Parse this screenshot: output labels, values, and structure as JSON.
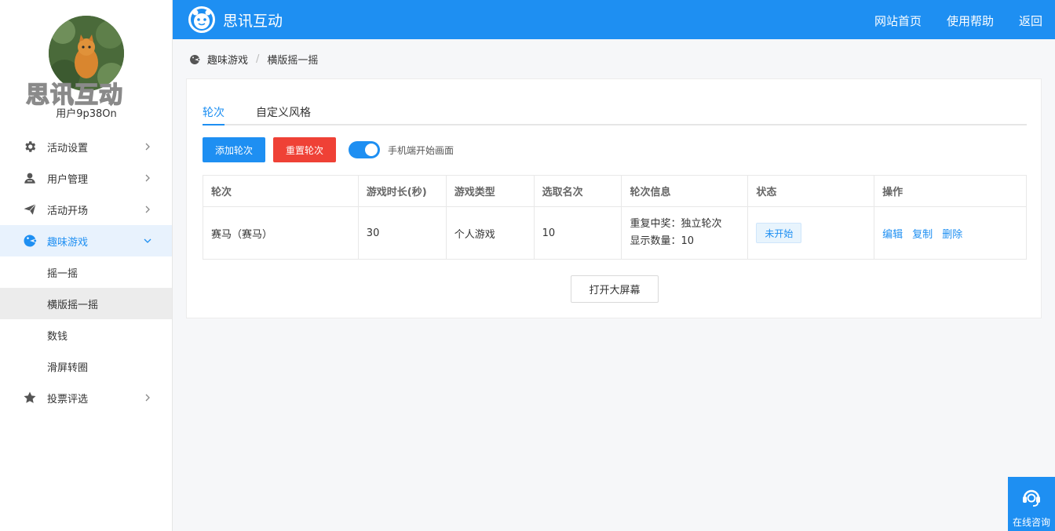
{
  "app": {
    "title": "思讯互动",
    "brand_watermark": "思讯互动",
    "username": "用户9p38On"
  },
  "topnav": {
    "home": "网站首页",
    "help": "使用帮助",
    "back": "返回"
  },
  "sidebar": {
    "items": [
      {
        "label": "活动设置",
        "icon": "gear-icon"
      },
      {
        "label": "用户管理",
        "icon": "user-icon"
      },
      {
        "label": "活动开场",
        "icon": "paper-plane-icon"
      },
      {
        "label": "趣味游戏",
        "icon": "game-icon"
      },
      {
        "label": "投票评选",
        "icon": "star-icon"
      }
    ],
    "submenu": [
      {
        "label": "摇一摇"
      },
      {
        "label": "横版摇一摇"
      },
      {
        "label": "数钱"
      },
      {
        "label": "滑屏转圈"
      }
    ]
  },
  "breadcrumb": {
    "parent": "趣味游戏",
    "separator": "/",
    "current": "横版摇一摇"
  },
  "tabs": [
    "轮次",
    "自定义风格"
  ],
  "actions": {
    "add_round": "添加轮次",
    "reset_rounds": "重置轮次",
    "toggle_label": "手机端开始画面",
    "toggle_on": true,
    "open_bigscreen": "打开大屏幕"
  },
  "table": {
    "headers": [
      "轮次",
      "游戏时长(秒)",
      "游戏类型",
      "选取名次",
      "轮次信息",
      "状态",
      "操作"
    ],
    "rows": [
      {
        "round": "赛马（赛马）",
        "duration": "30",
        "game_type": "个人游戏",
        "rank": "10",
        "info_line1": "重复中奖：独立轮次",
        "info_line2": "显示数量：10",
        "status": "未开始",
        "op_edit": "编辑",
        "op_copy": "复制",
        "op_delete": "删除"
      }
    ]
  },
  "float_help": {
    "label": "在线咨询"
  },
  "colors": {
    "primary": "#1e8ff2",
    "danger": "#ef4136",
    "sidebar_active_bg": "#e8f2fd"
  }
}
